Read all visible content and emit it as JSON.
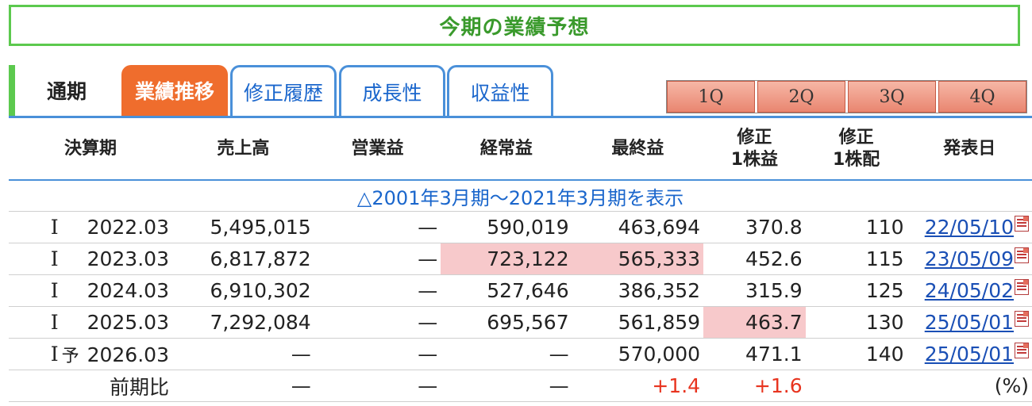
{
  "page_title": "今期の業績予想",
  "tabs": {
    "plain": "通期",
    "active": "業績推移",
    "links": [
      "修正履歴",
      "成長性",
      "収益性"
    ]
  },
  "quarter_buttons": [
    "1Q",
    "2Q",
    "3Q",
    "4Q"
  ],
  "table": {
    "headers": {
      "period": "決算期",
      "sales": "売上高",
      "operating": "営業益",
      "ordinary": "経常益",
      "net": "最終益",
      "eps_l1": "修正",
      "eps_l2": "1株益",
      "div_l1": "修正",
      "div_l2": "1株配",
      "date": "発表日"
    },
    "range_link": "△2001年3月期〜2021年3月期を表示",
    "rows": [
      {
        "mark": "I",
        "forecast": "",
        "period": "2022.03",
        "sales": "5,495,015",
        "operating": "—",
        "ordinary": "590,019",
        "net": "463,694",
        "eps": "370.8",
        "div": "110",
        "date": "22/05/10"
      },
      {
        "mark": "I",
        "forecast": "",
        "period": "2023.03",
        "sales": "6,817,872",
        "operating": "—",
        "ordinary": "723,122",
        "net": "565,333",
        "eps": "452.6",
        "div": "115",
        "date": "23/05/09"
      },
      {
        "mark": "I",
        "forecast": "",
        "period": "2024.03",
        "sales": "6,910,302",
        "operating": "—",
        "ordinary": "527,646",
        "net": "386,352",
        "eps": "315.9",
        "div": "125",
        "date": "24/05/02"
      },
      {
        "mark": "I",
        "forecast": "",
        "period": "2025.03",
        "sales": "7,292,084",
        "operating": "—",
        "ordinary": "695,567",
        "net": "561,859",
        "eps": "463.7",
        "div": "130",
        "date": "25/05/01"
      },
      {
        "mark": "I",
        "forecast": "予",
        "period": "2026.03",
        "sales": "—",
        "operating": "—",
        "ordinary": "—",
        "net": "570,000",
        "eps": "471.1",
        "div": "140",
        "date": "25/05/01"
      }
    ],
    "comparison": {
      "label": "前期比",
      "sales": "—",
      "operating": "—",
      "ordinary": "—",
      "net": "+1.4",
      "eps": "+1.6",
      "unit": "(%)"
    }
  },
  "colors": {
    "accent_green": "#5cc94e",
    "active_tab": "#ef6d2d",
    "link_blue": "#1a66cc",
    "highlight_pink": "#f7c9cb",
    "positive_red": "#e8341f"
  },
  "icons": {
    "date_icon": "pdf-icon"
  }
}
